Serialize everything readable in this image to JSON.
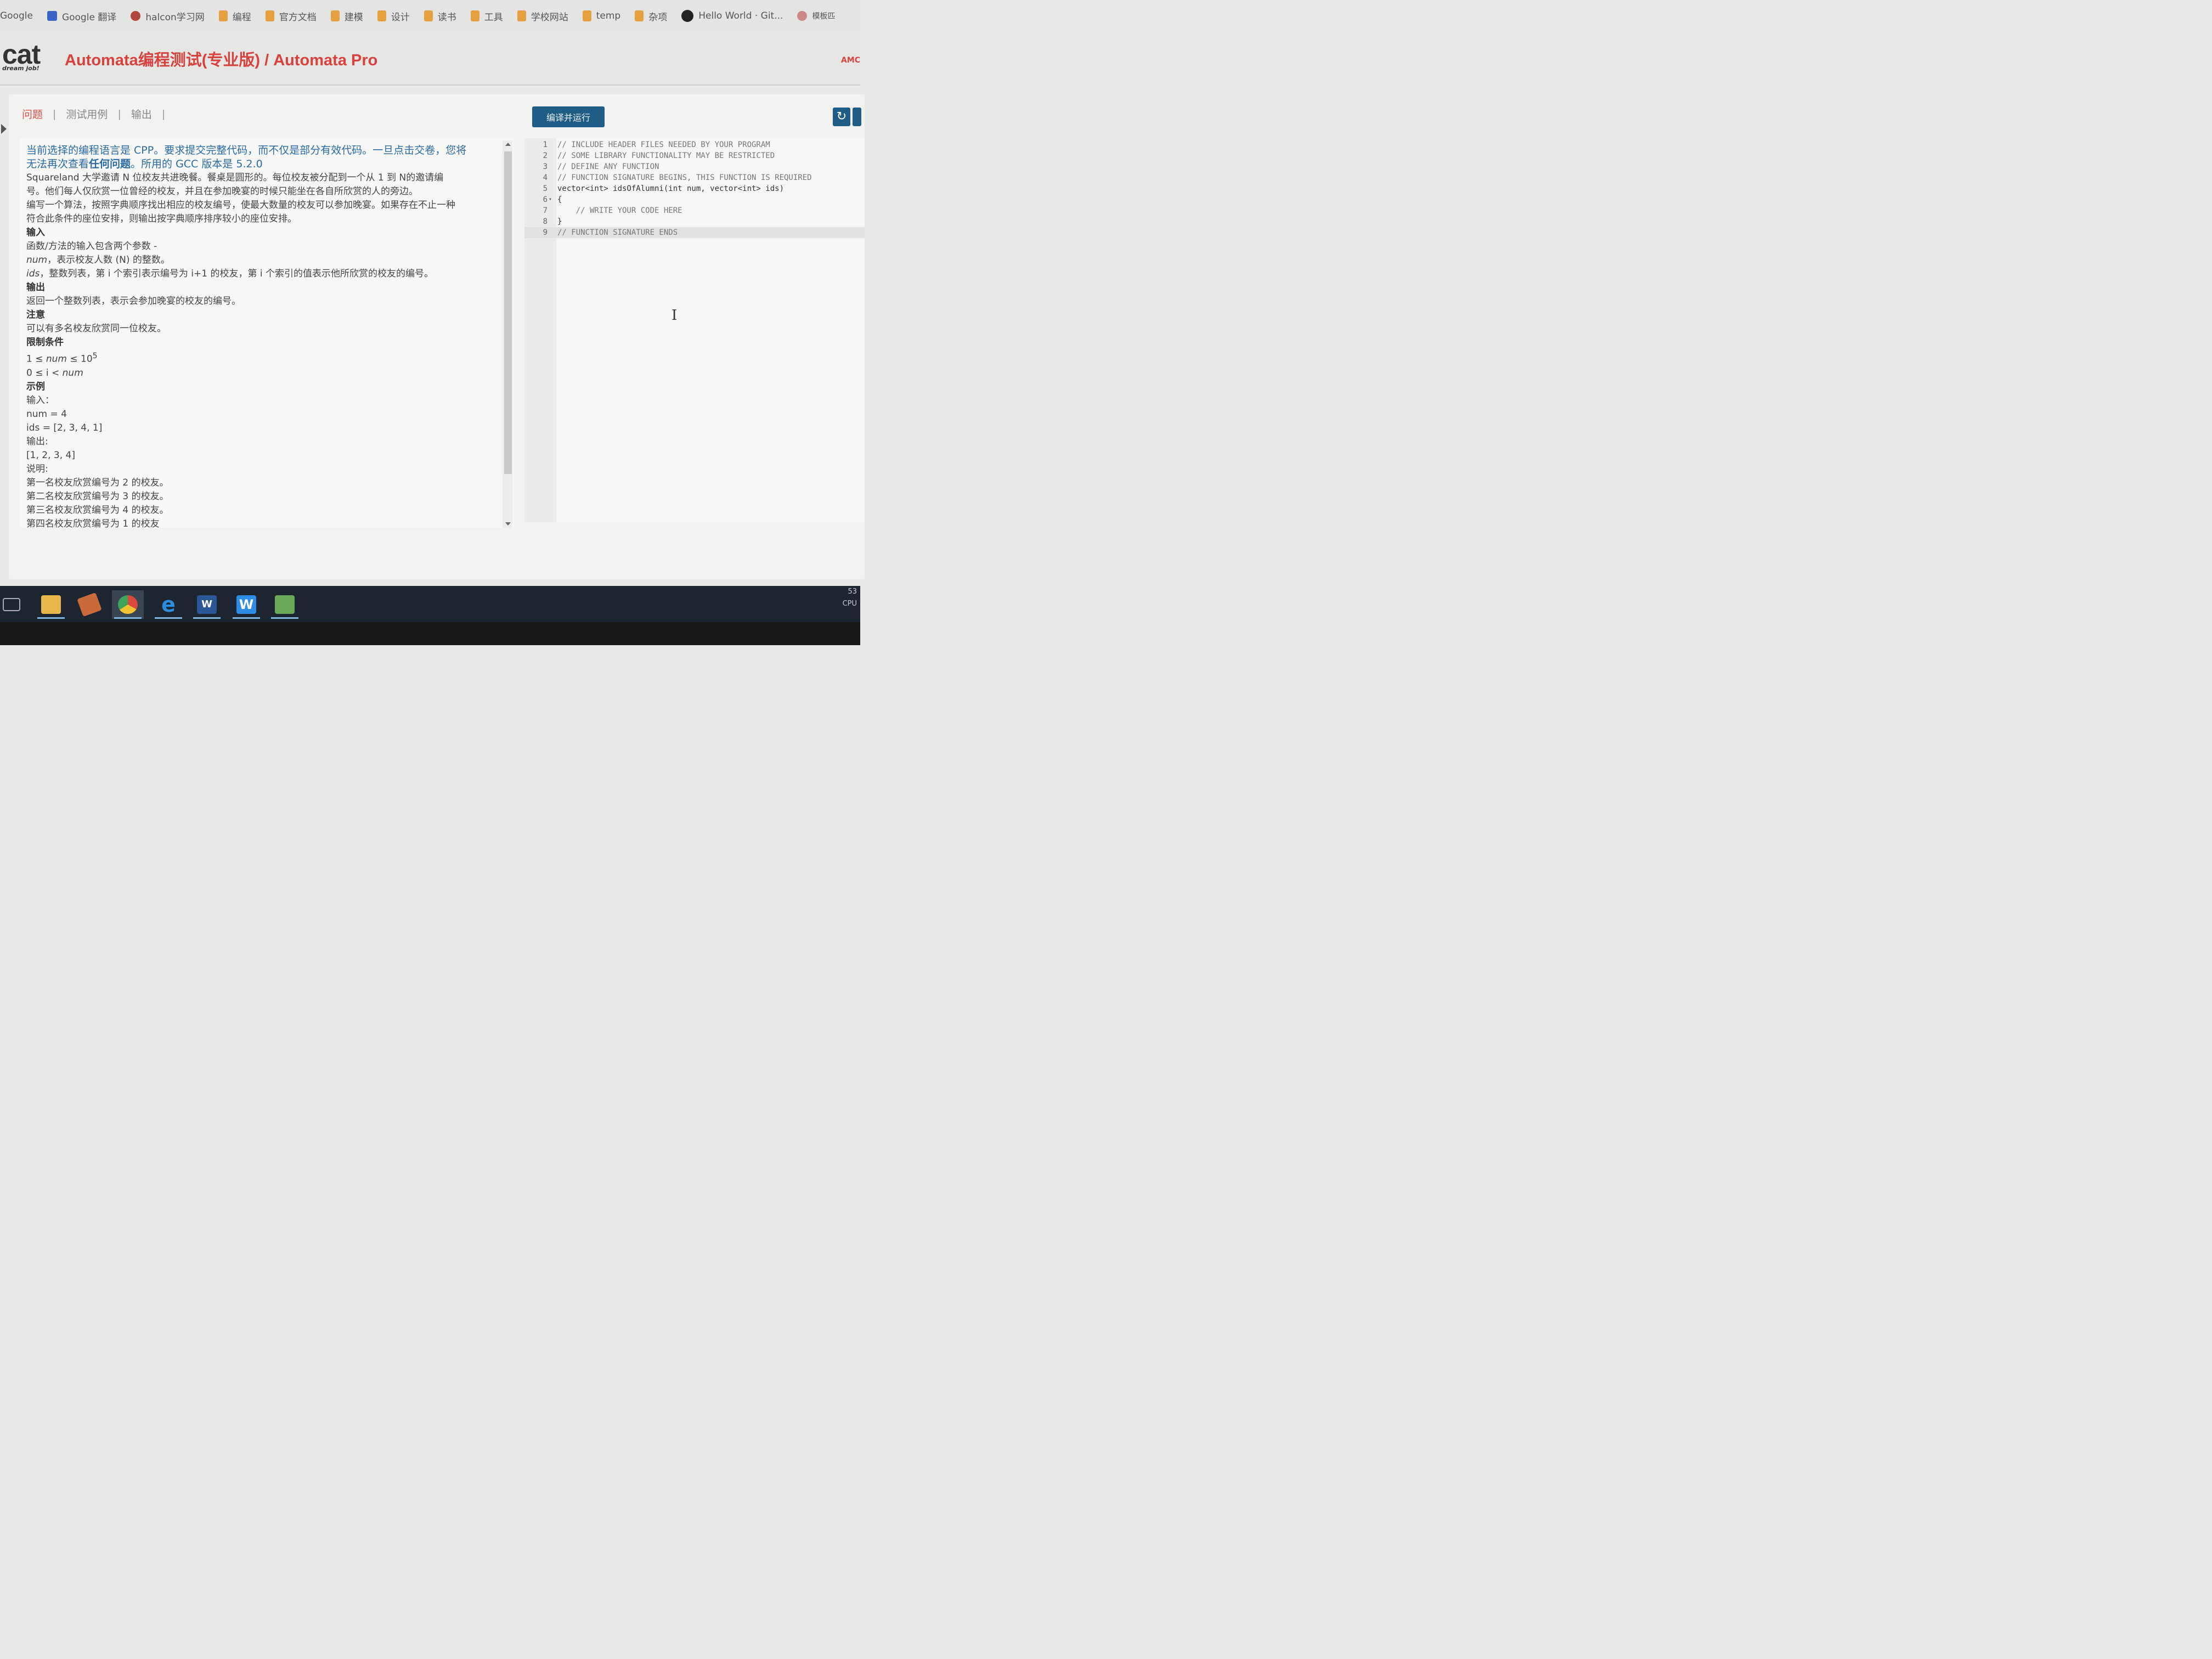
{
  "bookmarks": [
    {
      "label": "Google",
      "icon": "none"
    },
    {
      "label": "Google 翻译",
      "icon": "translate-icon"
    },
    {
      "label": "halcon学习网",
      "icon": "site-icon"
    },
    {
      "label": "编程",
      "icon": "folder-icon"
    },
    {
      "label": "官方文档",
      "icon": "folder-icon"
    },
    {
      "label": "建模",
      "icon": "folder-icon"
    },
    {
      "label": "设计",
      "icon": "folder-icon"
    },
    {
      "label": "读书",
      "icon": "folder-icon"
    },
    {
      "label": "工具",
      "icon": "folder-icon"
    },
    {
      "label": "学校网站",
      "icon": "folder-icon"
    },
    {
      "label": "temp",
      "icon": "folder-icon"
    },
    {
      "label": "杂项",
      "icon": "folder-icon"
    },
    {
      "label": "Hello World · Git...",
      "icon": "github-icon"
    },
    {
      "label": "模板匹",
      "icon": "site-icon"
    }
  ],
  "header": {
    "logo": "cat",
    "logo_sub": "dream job!",
    "title": "Automata编程测试(专业版) / Automata Pro",
    "right_text": "AMC"
  },
  "tabs": [
    {
      "label": "问题",
      "active": true
    },
    {
      "label": "测试用例",
      "active": false
    },
    {
      "label": "输出",
      "active": false
    }
  ],
  "toolbar": {
    "run_label": "编译并运行",
    "reset_icon": "reset-icon",
    "save_icon": "save-icon"
  },
  "problem": {
    "notice_1": "当前选择的编程语言是 CPP。要求提交完整代码，而不仅是部分有效代码。一旦点击交卷，您将",
    "notice_2a": "无法再次查看",
    "notice_2b": "任何问题",
    "notice_2c": "。所用的 GCC 版本是 5.2.0",
    "desc_1": "Squareland 大学邀请 N 位校友共进晚餐。餐桌是圆形的。每位校友被分配到一个从 1 到 N的邀请编",
    "desc_2": "号。他们每人仅欣赏一位曾经的校友，并且在参加晚宴的时候只能坐在各自所欣赏的人的旁边。",
    "desc_3": "编写一个算法，按照字典顺序找出相应的校友编号，使最大数量的校友可以参加晚宴。如果存在不止一种",
    "desc_4": "符合此条件的座位安排，则输出按字典顺序排序较小的座位安排。",
    "input_heading": "输入",
    "input_1": "函数/方法的输入包含两个参数 -",
    "input_num_name": "num",
    "input_num_desc": "，表示校友人数 (N) 的整数。",
    "input_ids_name": "ids",
    "input_ids_desc": "，整数列表，第 i 个索引表示编号为 i+1 的校友，第 i 个索引的值表示他所欣赏的校友的编号。",
    "output_heading": "输出",
    "output_1": "返回一个整数列表，表示会参加晚宴的校友的编号。",
    "note_heading": "注意",
    "note_1": "可以有多名校友欣赏同一位校友。",
    "constraints_heading": "限制条件",
    "constraint_1a": "1 ≤ ",
    "constraint_1b": "num",
    "constraint_1c": " ≤ 10",
    "constraint_1sup": "5",
    "constraint_2a": "0 ≤ i < ",
    "constraint_2b": "num",
    "example_heading": "示例",
    "ex_input_label": "输入：",
    "ex_num": "num = 4",
    "ex_ids": "ids = [2, 3, 4, 1]",
    "ex_output_label": "输出:",
    "ex_output": "[1, 2, 3, 4]",
    "ex_explain_label": "说明:",
    "ex_explain_1": "第一名校友欣赏编号为 2 的校友。",
    "ex_explain_2": "第二名校友欣赏编号为 3 的校友。",
    "ex_explain_3": "第三名校友欣赏编号为 4 的校友。",
    "ex_explain_4": "第四名校友欣赏编号为 1 的校友"
  },
  "editor": {
    "lines": [
      {
        "num": "1",
        "text": "// INCLUDE HEADER FILES NEEDED BY YOUR PROGRAM",
        "comment": true
      },
      {
        "num": "2",
        "text": "// SOME LIBRARY FUNCTIONALITY MAY BE RESTRICTED",
        "comment": true
      },
      {
        "num": "3",
        "text": "// DEFINE ANY FUNCTION",
        "comment": true
      },
      {
        "num": "4",
        "text": "// FUNCTION SIGNATURE BEGINS, THIS FUNCTION IS REQUIRED",
        "comment": true
      },
      {
        "num": "5",
        "text": "vector<int> idsOfAlumni(int num, vector<int> ids)",
        "comment": false
      },
      {
        "num": "6",
        "text": "{",
        "comment": false
      },
      {
        "num": "7",
        "text": "    // WRITE YOUR CODE HERE",
        "comment": true
      },
      {
        "num": "8",
        "text": "}",
        "comment": false
      },
      {
        "num": "9",
        "text": "// FUNCTION SIGNATURE ENDS",
        "comment": true
      }
    ],
    "active_line": "9",
    "cursor_glyph": "I"
  },
  "taskbar": {
    "items": [
      "task-view-icon",
      "file-explorer-icon",
      "book-app-icon",
      "chrome-icon",
      "edge-icon",
      "word-icon",
      "wps-writer-icon",
      "image-app-icon"
    ],
    "tray_1": "53",
    "tray_2": "CPU"
  },
  "colors": {
    "accent_red": "#d9423c",
    "button_blue": "#1f5d86",
    "notice_blue": "#2a6aa4"
  }
}
